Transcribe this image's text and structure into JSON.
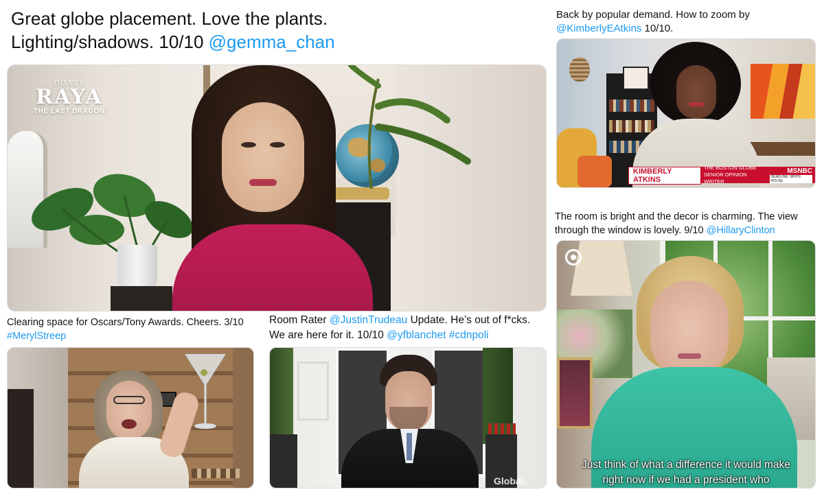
{
  "tweets": [
    {
      "text": "Great globe placement. Love the plants.",
      "text2": "Lighting/shadows. 10/10 ",
      "handle": "@gemma_chan",
      "video": {
        "logo_brand": "DISNEY",
        "logo_title": "RAYA",
        "logo_subtitle": "THE LAST DRAGON"
      }
    },
    {
      "text": "Back by popular demand. How to zoom by",
      "handle": "@KimberlyEAtkins",
      "rating": " 10/10.",
      "video": {
        "chyron_name": "KIMBERLY ATKINS",
        "chyron_outlet": "THE BOSTON GLOBE",
        "chyron_role": "SENIOR OPINION WRITER",
        "network": "MSNBC",
        "ticker": "DEADLINE: WHITE HOUSE"
      }
    },
    {
      "text": "The room is bright and the decor is charming. The view",
      "text2": "through  the window is lovely. 9/10 ",
      "handle": "@HillaryClinton",
      "video": {
        "subtitle_line1": "Just think of what a difference it would make",
        "subtitle_line2": "right now if we had a president who"
      }
    },
    {
      "text": "Clearing space for Oscars/Tony Awards. Cheers. 3/10",
      "handle": "#MerylStreep"
    },
    {
      "text": "Room Rater ",
      "handle": "@JustinTrudeau",
      "text2": " Update. He’s out of f*cks.",
      "text3": "We are here for it. 10/10 ",
      "handle2": "@yfblanchet",
      "handle3": "#cdnpoli",
      "video": {
        "network": "Global"
      }
    }
  ],
  "colors": {
    "mention": "#1d9bf0",
    "msnbc_red": "#c8102e",
    "cbs_eye": "#ffffff"
  }
}
